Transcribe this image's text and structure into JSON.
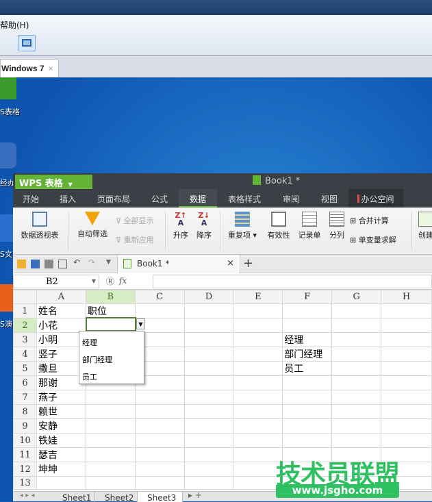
{
  "host": {
    "menu_help": "帮助(H)",
    "vm_tab": "Windows 7",
    "vm_tab_close": "×"
  },
  "desktop": {
    "icons": [
      {
        "label": "S表格",
        "color": "#3a9a2a"
      },
      {
        "label": "经办",
        "color": "#3a6fc0"
      },
      {
        "label": "S文",
        "color": "#2a6fd0"
      },
      {
        "label": "S演",
        "color": "#e8601c"
      }
    ]
  },
  "wps": {
    "app_name": "WPS 表格",
    "doc_title": "Book1 *",
    "menu_tabs": [
      "开始",
      "插入",
      "页面布局",
      "公式",
      "数据",
      "表格样式",
      "审阅",
      "视图",
      "办公空间"
    ],
    "active_tab": "数据",
    "ribbon": {
      "pivot": "数据透视表",
      "autofilter": "自动筛选",
      "show_all": "全部显示",
      "reapply": "重新应用",
      "sort_asc": "升序",
      "sort_desc": "降序",
      "duplicates": "重复项",
      "validity": "有效性",
      "record": "记录单",
      "split": "分列",
      "consolidate": "合并计算",
      "what_if": "单变量求解",
      "create": "创建"
    },
    "book_tab": "Book1 *",
    "book_tab_close": "×",
    "add_tab": "+",
    "name_box": "B2",
    "fx": "fx",
    "columns": [
      "A",
      "B",
      "C",
      "D",
      "E",
      "F",
      "G",
      "H"
    ],
    "rows": [
      [
        "姓名",
        "职位",
        "",
        "",
        "",
        "",
        "",
        ""
      ],
      [
        "小花",
        "",
        "",
        "",
        "",
        "",
        "",
        ""
      ],
      [
        "小明",
        "",
        "",
        "",
        "",
        "经理",
        "",
        ""
      ],
      [
        "竖子",
        "",
        "",
        "",
        "",
        "部门经理",
        "",
        ""
      ],
      [
        "撒旦",
        "",
        "",
        "",
        "",
        "员工",
        "",
        ""
      ],
      [
        "那谢",
        "",
        "",
        "",
        "",
        "",
        "",
        ""
      ],
      [
        "燕子",
        "",
        "",
        "",
        "",
        "",
        "",
        ""
      ],
      [
        "赖世",
        "",
        "",
        "",
        "",
        "",
        "",
        ""
      ],
      [
        "安静",
        "",
        "",
        "",
        "",
        "",
        "",
        ""
      ],
      [
        "铁娃",
        "",
        "",
        "",
        "",
        "",
        "",
        ""
      ],
      [
        "瑟吉",
        "",
        "",
        "",
        "",
        "",
        "",
        ""
      ],
      [
        "坤坤",
        "",
        "",
        "",
        "",
        "",
        "",
        ""
      ],
      [
        "",
        "",
        "",
        "",
        "",
        "",
        "",
        ""
      ],
      [
        "",
        "",
        "",
        "",
        "",
        "",
        "",
        ""
      ]
    ],
    "dropdown_options": [
      "经理",
      "部门经理",
      "员工"
    ],
    "sheets": [
      "Sheet1",
      "Sheet2",
      "Sheet3"
    ],
    "active_sheet": "Sheet3"
  },
  "watermark": {
    "text": "技术员联盟",
    "url": "www.jsgho.com",
    "color": "#2fc062"
  },
  "colors": {
    "accent": "#63b336",
    "titlebar": "#3c4046"
  }
}
